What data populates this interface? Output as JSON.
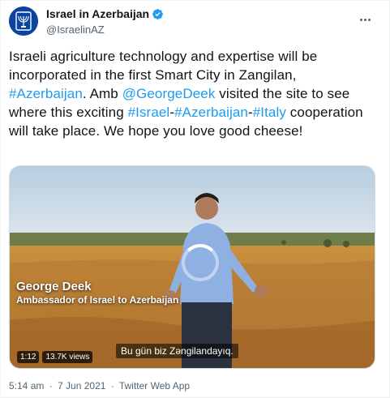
{
  "account": {
    "display_name": "Israel in Azerbaijan",
    "handle": "@IsraelinAZ"
  },
  "tweet": {
    "t1": "Israeli agriculture technology and expertise will be incorporated in the first Smart City in Zangilan, ",
    "tag_azerbaijan": "#Azerbaijan",
    "t2": ". Amb ",
    "mention": "@GeorgeDeek",
    "t3": " visited the site to see where this exciting ",
    "tag_israel": "#Israel",
    "dash1": "-",
    "tag_azerbaijan2": "#Azerbaijan",
    "dash2": "-",
    "tag_italy": "#Italy",
    "t4": " cooperation will take place. We hope you love good cheese!"
  },
  "video": {
    "caption_name": "George Deek",
    "caption_role": "Ambassador of Israel to Azerbaijan",
    "subtitle": "Bu gün biz Zəngilandayıq.",
    "duration": "1:12",
    "views": "13.7K views"
  },
  "meta": {
    "time": "5:14 am",
    "separator1": "·",
    "date": "7 Jun 2021",
    "separator2": "·",
    "source": "Twitter Web App"
  },
  "colors": {
    "link": "#1d9bf0",
    "avatar_bg": "#0a43a0",
    "verified": "#1d9bf0"
  }
}
